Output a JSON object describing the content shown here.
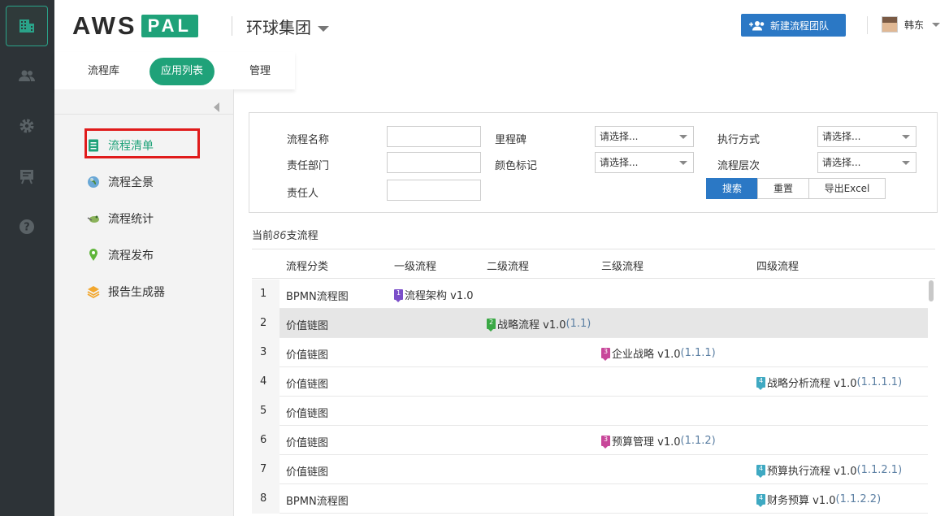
{
  "header": {
    "logo_main": "AWS",
    "logo_sub": "PAL",
    "org_name": "环球集团",
    "new_team_button": "新建流程团队",
    "user_name": "韩东"
  },
  "rail": {
    "items": [
      {
        "icon": "building-icon",
        "active": true
      },
      {
        "icon": "users-icon"
      },
      {
        "icon": "gear-icon"
      },
      {
        "icon": "board-icon"
      },
      {
        "icon": "help-icon"
      }
    ]
  },
  "tabs": [
    "流程库",
    "应用列表",
    "管理"
  ],
  "sidebar": {
    "items": [
      {
        "label": "流程清单",
        "icon": "list-icon"
      },
      {
        "label": "流程全景",
        "icon": "globe-icon"
      },
      {
        "label": "流程统计",
        "icon": "stats-icon"
      },
      {
        "label": "流程发布",
        "icon": "pin-icon"
      },
      {
        "label": "报告生成器",
        "icon": "layers-icon"
      }
    ]
  },
  "filter": {
    "name_label": "流程名称",
    "dept_label": "责任部门",
    "owner_label": "责任人",
    "milestone_label": "里程碑",
    "color_label": "颜色标记",
    "exec_label": "执行方式",
    "level_label": "流程层次",
    "select_placeholder": "请选择...",
    "search_button": "搜索",
    "reset_button": "重置",
    "export_button": "导出Excel"
  },
  "count": {
    "prefix": "当前",
    "num": "86",
    "suffix": "支流程"
  },
  "table": {
    "headers": [
      "流程分类",
      "一级流程",
      "二级流程",
      "三级流程",
      "四级流程"
    ],
    "rows": [
      {
        "idx": "1",
        "cat": "BPMN流程图",
        "level": 1,
        "name": "流程架构 v1.0",
        "code": ""
      },
      {
        "idx": "2",
        "cat": "价值链图",
        "level": 2,
        "name": "战略流程 v1.0",
        "code": "(1.1)"
      },
      {
        "idx": "3",
        "cat": "价值链图",
        "level": 3,
        "name": "企业战略 v1.0",
        "code": "(1.1.1)"
      },
      {
        "idx": "4",
        "cat": "价值链图",
        "level": 4,
        "name": "战略分析流程 v1.0",
        "code": "(1.1.1.1)"
      },
      {
        "idx": "5",
        "cat": "价值链图",
        "level": 0,
        "name": "",
        "code": ""
      },
      {
        "idx": "6",
        "cat": "价值链图",
        "level": 3,
        "name": "预算管理 v1.0",
        "code": "(1.1.2)"
      },
      {
        "idx": "7",
        "cat": "价值链图",
        "level": 4,
        "name": "预算执行流程 v1.0",
        "code": "(1.1.2.1)"
      },
      {
        "idx": "8",
        "cat": "BPMN流程图",
        "level": 4,
        "name": "财务预算 v1.0",
        "code": "(1.1.2.2)"
      }
    ],
    "badge_colors": {
      "1": "#7b4fc9",
      "2": "#3aa845",
      "3": "#c8479a",
      "4": "#3fa9c2"
    },
    "highlight_row": "2"
  }
}
